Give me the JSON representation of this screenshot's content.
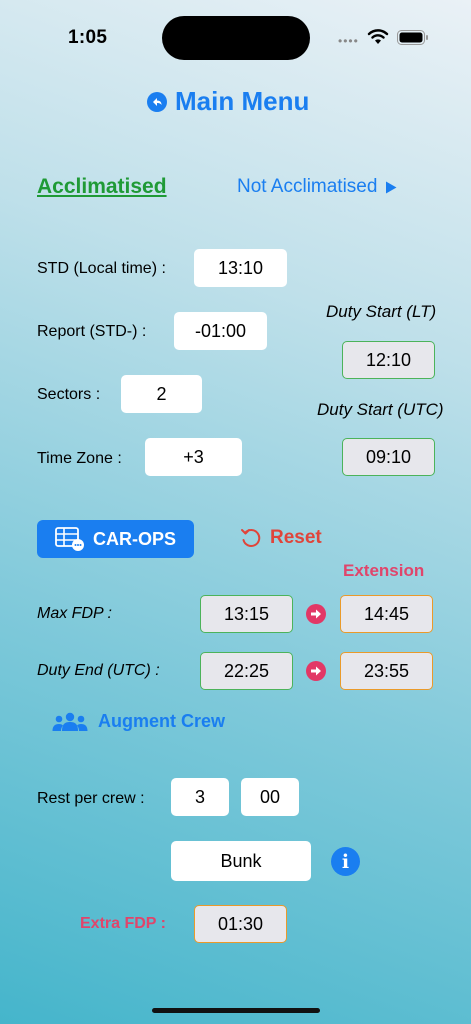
{
  "status": {
    "time": "1:05"
  },
  "header": {
    "title": "Main Menu"
  },
  "mode": {
    "selected": "Acclimatised",
    "other": "Not Acclimatised"
  },
  "inputs": {
    "std_label": "STD (Local time) :",
    "std_value": "13:10",
    "report_label": "Report (STD-) :",
    "report_value": "-01:00",
    "sectors_label": "Sectors :",
    "sectors_value": "2",
    "timezone_label": "Time Zone :",
    "timezone_value": "+3"
  },
  "duty_start": {
    "lt_label": "Duty Start (LT)",
    "lt_value": "12:10",
    "utc_label": "Duty Start (UTC)",
    "utc_value": "09:10"
  },
  "actions": {
    "carops_label": "CAR-OPS",
    "reset_label": "Reset"
  },
  "results": {
    "extension_label": "Extension",
    "max_fdp_label": "Max FDP :",
    "max_fdp_value": "13:15",
    "max_fdp_ext": "14:45",
    "duty_end_label": "Duty End (UTC) :",
    "duty_end_value": "22:25",
    "duty_end_ext": "23:55"
  },
  "augment": {
    "label": "Augment Crew",
    "rest_label": "Rest per crew :",
    "rest_hours": "3",
    "rest_minutes": "00",
    "facility": "Bunk",
    "extra_fdp_label": "Extra FDP :",
    "extra_fdp_value": "01:30"
  },
  "colors": {
    "accent": "#1a7ef0",
    "green": "#1f9a36",
    "red": "#e0443a",
    "pink": "#e0456b"
  },
  "icons": [
    "back-icon",
    "play-icon",
    "table-icon",
    "reset-icon",
    "arrow-right-icon",
    "people-icon",
    "info-icon"
  ]
}
